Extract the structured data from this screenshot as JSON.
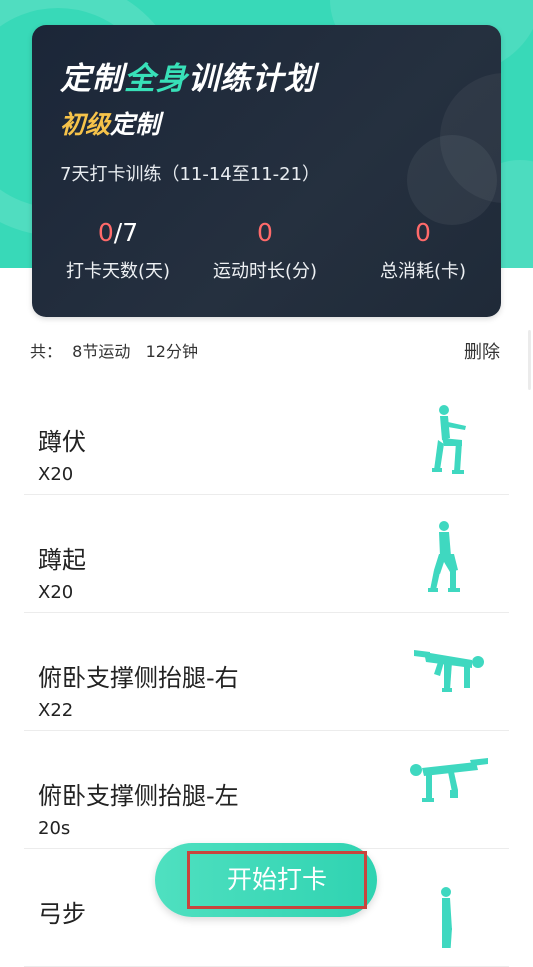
{
  "plan": {
    "title_part1": "定制",
    "title_highlight": "全身",
    "title_part2": "训练计划",
    "level_highlight": "初级",
    "level_rest": "定制",
    "period": "7天打卡训练（11-14至11-21）"
  },
  "stats": {
    "checkin_done": "0",
    "checkin_total": "/7",
    "checkin_label": "打卡天数(天)",
    "duration_value": "0",
    "duration_label": "运动时长(分)",
    "calories_value": "0",
    "calories_label": "总消耗(卡)"
  },
  "summary": {
    "text": "共：  8节运动   12分钟",
    "delete_label": "删除"
  },
  "exercises": [
    {
      "name": "蹲伏",
      "reps": "X20",
      "icon": "squat-pose-icon"
    },
    {
      "name": "蹲起",
      "reps": "X20",
      "icon": "squat-up-pose-icon"
    },
    {
      "name": "俯卧支撑侧抬腿-右",
      "reps": "X22",
      "icon": "plank-leg-raise-right-icon"
    },
    {
      "name": "俯卧支撑侧抬腿-左",
      "reps": "20s",
      "icon": "plank-leg-raise-left-icon"
    },
    {
      "name": "弓步",
      "reps": "",
      "icon": "lunge-pose-icon"
    }
  ],
  "start_button": {
    "label": "开始打卡"
  },
  "colors": {
    "teal": "#38d9b8",
    "card_dark": "#1f2a38",
    "accent_green": "#38e0b8",
    "accent_yellow": "#f6c34a",
    "stat_red": "#ff6a6a"
  }
}
